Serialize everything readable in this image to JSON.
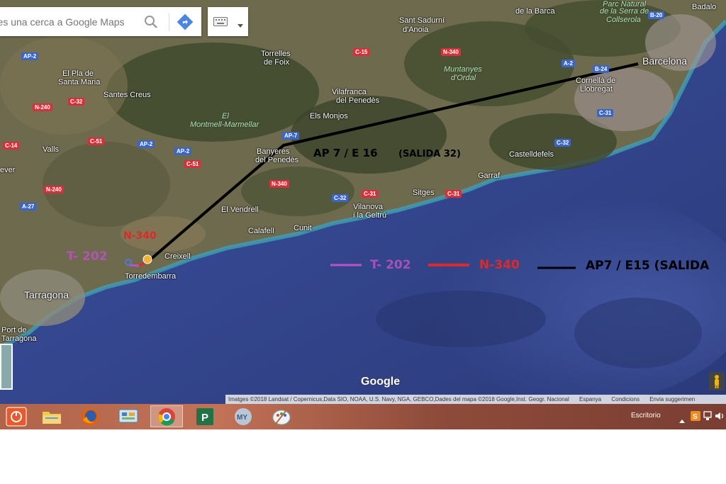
{
  "search": {
    "placeholder": "Fes una cerca a Google Maps"
  },
  "icons": {
    "search": "search-icon",
    "directions": "directions-icon",
    "keyboard": "keyboard-icon",
    "dropdown": "chevron-down-icon"
  },
  "places": {
    "badalona": "Badalo",
    "la_barca": "de la Barca",
    "sant_sadurni": "Sant Sadurní",
    "anoia": "d'Anoia",
    "parc": "Parc Natural",
    "serra": "de la Serra de",
    "collserola": "Collserola",
    "torrelles": "Torrelles",
    "foix": "de Foix",
    "barcelona": "Barcelona",
    "pla": "El Pla de",
    "santa_maria": "Santa Maria",
    "santes_creus": "Santes Creus",
    "vilafranca": "Vilafranca",
    "penedes": "del Penedès",
    "muntanyes": "Muntanyes",
    "ordal": "d'Ordal",
    "cornella": "Cornellà de",
    "llobregat": "Llobregat",
    "el": "El",
    "montmell": "Montmell-Marmellar",
    "monjos": "Els Monjos",
    "valls": "Valls",
    "banyeres": "Banyeres",
    "banyeres2": "del Penedès",
    "castelldefels": "Castelldefels",
    "garraf": "Garraf",
    "sitges": "Sitges",
    "vendrell": "El Vendrell",
    "vilanova": "Vilanova",
    "geltru": "i la Geltrú",
    "calafell": "Calafell",
    "cunit": "Cunit",
    "creixell": "Creixell",
    "torredembarra": "Torredembarra",
    "tarragona": "Tarragona",
    "tarragona2": "Port de",
    "tarragona3": "Tarragona",
    "ever": "ever"
  },
  "road_shields": {
    "ap2_a": "AP-2",
    "n240_a": "N-240",
    "c32_a": "C-32",
    "c15": "C-15",
    "n340_a": "N-340",
    "b20": "B-20",
    "a2": "A-2",
    "b24": "B-24",
    "c14": "C-14",
    "c51": "C-51",
    "ap2_b": "AP-2",
    "ap2_c": "AP-2",
    "c51_b": "C-51",
    "ap7": "AP-7",
    "c31": "C-31",
    "c32_b": "C-32",
    "n240_b": "N-240",
    "n340_b": "N-340",
    "c32_c": "C-32",
    "c31_b": "C-31",
    "c31_c": "C-31",
    "a27": "A-27"
  },
  "overlay": {
    "ap7_map": "AP 7 / E 16",
    "salida_map": "(SALIDA 32)",
    "n340_map": "N-340",
    "t202_map": "T- 202"
  },
  "legend": {
    "t202": "T- 202",
    "n340": "N-340",
    "ap7": "AP7 / E15 (SALIDA"
  },
  "colors": {
    "t202": "#c050c8",
    "n340": "#e02828",
    "ap7": "#000000"
  },
  "google_logo": "Google",
  "attribution": {
    "imagery": "Imatges ©2018 Landsat / Copernicus,Data SIO, NOAA, U.S. Navy, NGA, GEBCO,Dades del mapa ©2018 Google,Inst. Geogr. Nacional",
    "country": "Espanya",
    "terms": "Condicions",
    "feedback": "Envia suggerimen"
  },
  "taskbar": {
    "apps": [
      "power-icon",
      "file-explorer-icon",
      "firefox-icon",
      "control-panel-icon",
      "chrome-icon",
      "project-icon",
      "my-icon",
      "paint-icon"
    ],
    "tray_label": "Escritorio"
  }
}
